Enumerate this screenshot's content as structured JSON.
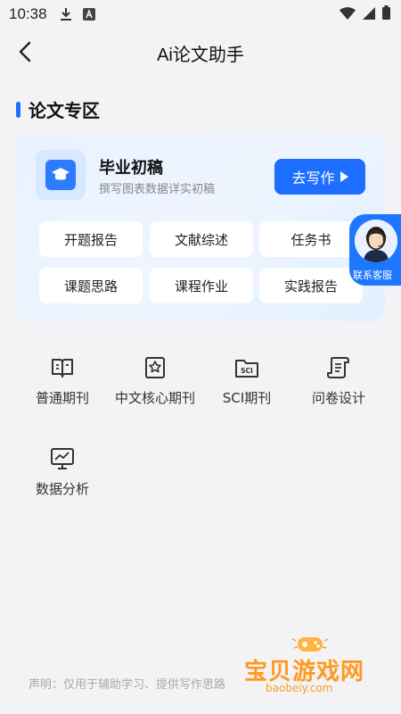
{
  "status_bar": {
    "time": "10:38"
  },
  "header": {
    "title": "Ai论文助手"
  },
  "section": {
    "title": "论文专区"
  },
  "card": {
    "title": "毕业初稿",
    "subtitle": "撰写图表数据详实初稿",
    "button_label": "去写作",
    "chips": [
      "开题报告",
      "文献综述",
      "任务书",
      "课题思路",
      "课程作业",
      "实践报告"
    ]
  },
  "service": {
    "label": "联系客服"
  },
  "grid": {
    "items": [
      {
        "label": "普通期刊",
        "icon": "book-icon"
      },
      {
        "label": "中文核心期刊",
        "icon": "bookmark-star-icon"
      },
      {
        "label": "SCI期刊",
        "icon": "sci-folder-icon"
      },
      {
        "label": "问卷设计",
        "icon": "scroll-icon"
      },
      {
        "label": "数据分析",
        "icon": "chart-monitor-icon"
      }
    ]
  },
  "footer": {
    "disclaimer": "声明：仅用于辅助学习、提供写作思路"
  },
  "watermark": {
    "text": "宝贝游戏网",
    "url": "baobeiy.com"
  },
  "colors": {
    "accent": "#1e6fff",
    "background": "#f3f3f5",
    "card_bg": "#e9f2ff"
  }
}
